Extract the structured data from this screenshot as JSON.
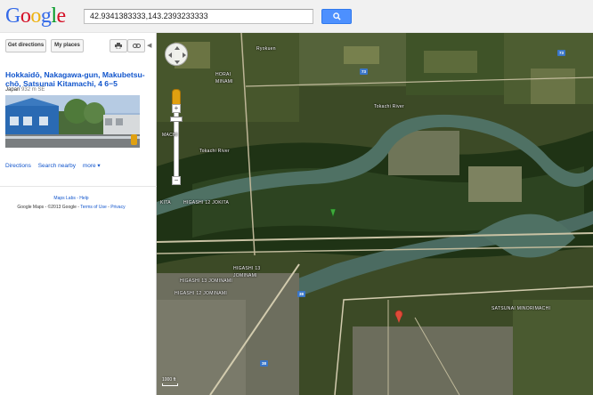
{
  "header": {
    "logo_letters": [
      {
        "ch": "G",
        "color": "#3369e8"
      },
      {
        "ch": "o",
        "color": "#d50f25"
      },
      {
        "ch": "o",
        "color": "#eeb211"
      },
      {
        "ch": "g",
        "color": "#3369e8"
      },
      {
        "ch": "l",
        "color": "#009925"
      },
      {
        "ch": "e",
        "color": "#d50f25"
      }
    ],
    "search_value": "42.9341383333,143.2393233333",
    "search_button_icon": "search-icon"
  },
  "panel": {
    "get_directions": "Get directions",
    "my_places": "My places",
    "print_icon": "print-icon",
    "link_icon": "link-icon",
    "collapse_icon": "collapse-arrow-icon",
    "address_title": "Hokkaidō, Nakagawa-gun, Makubetsu-chō, Satsunai Kitamachi, 4 6−5",
    "country": "Japan",
    "distance": "932 m SE",
    "links": {
      "directions": "Directions",
      "search_nearby": "Search nearby",
      "more": "more ▾"
    },
    "footer_labs": "Maps Labs - Help",
    "footer_brand": "Google Maps",
    "footer_copyright": "- ©2013 Google -",
    "footer_terms": "Terms of Use",
    "footer_sep": "-",
    "footer_privacy": "Privacy"
  },
  "map": {
    "labels": {
      "ryokuen": "Ryokuen",
      "horai": "HORAI",
      "minami": "MINAMI",
      "horai_minami": "HORAI MINAMI",
      "tokachi_river_1": "Tokachi River",
      "tokachi_river_2": "Tokachi River",
      "jokita": "HIGASHI 12 JOKITA",
      "kita": "KITA",
      "higashi13": "HIGASHI 13 JOMINAMI",
      "higashi12": "HIGASHI 12 JOMINAMI",
      "higashi13b": "HIGASHI 13",
      "satsunai": "SATSUNAI MINORIMACHI",
      "chome": "JOMINAMI",
      "machi": "MACHI"
    },
    "routes": [
      "73",
      "73",
      "38",
      "38"
    ],
    "scale": "1000 ft"
  }
}
